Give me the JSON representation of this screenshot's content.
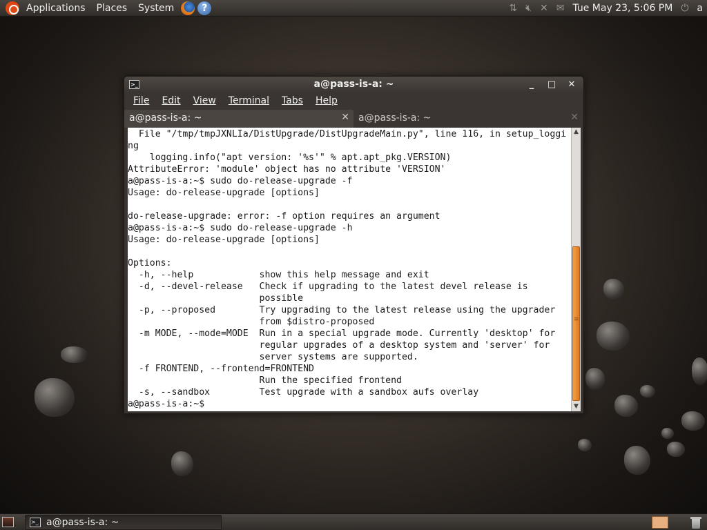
{
  "top_panel": {
    "menus": [
      "Applications",
      "Places",
      "System"
    ],
    "clock": "Tue May 23,  5:06 PM",
    "user": "a"
  },
  "window": {
    "title": "a@pass-is-a: ~",
    "menu": [
      {
        "label": "File"
      },
      {
        "label": "Edit"
      },
      {
        "label": "View"
      },
      {
        "label": "Terminal"
      },
      {
        "label": "Tabs"
      },
      {
        "label": "Help"
      }
    ],
    "tabs": [
      {
        "label": "a@pass-is-a: ~",
        "active": true
      },
      {
        "label": "a@pass-is-a: ~",
        "active": false
      }
    ],
    "terminal_lines": [
      "  File \"/tmp/tmpJXNLIa/DistUpgrade/DistUpgradeMain.py\", line 116, in setup_loggi",
      "ng",
      "    logging.info(\"apt version: '%s'\" % apt.apt_pkg.VERSION)",
      "AttributeError: 'module' object has no attribute 'VERSION'",
      "a@pass-is-a:~$ sudo do-release-upgrade -f",
      "Usage: do-release-upgrade [options]",
      "",
      "do-release-upgrade: error: -f option requires an argument",
      "a@pass-is-a:~$ sudo do-release-upgrade -h",
      "Usage: do-release-upgrade [options]",
      "",
      "Options:",
      "  -h, --help            show this help message and exit",
      "  -d, --devel-release   Check if upgrading to the latest devel release is",
      "                        possible",
      "  -p, --proposed        Try upgrading to the latest release using the upgrader",
      "                        from $distro-proposed",
      "  -m MODE, --mode=MODE  Run in a special upgrade mode. Currently 'desktop' for",
      "                        regular upgrades of a desktop system and 'server' for",
      "                        server systems are supported.",
      "  -f FRONTEND, --frontend=FRONTEND",
      "                        Run the specified frontend",
      "  -s, --sandbox         Test upgrade with a sandbox aufs overlay",
      "a@pass-is-a:~$"
    ],
    "scrollbar_position": 0.85
  },
  "bottom_panel": {
    "task_label": "a@pass-is-a: ~"
  },
  "icons": {
    "ubuntu": "ubuntu-logo-icon",
    "firefox": "firefox-icon",
    "help": "help-icon",
    "trash": "trash-icon"
  }
}
